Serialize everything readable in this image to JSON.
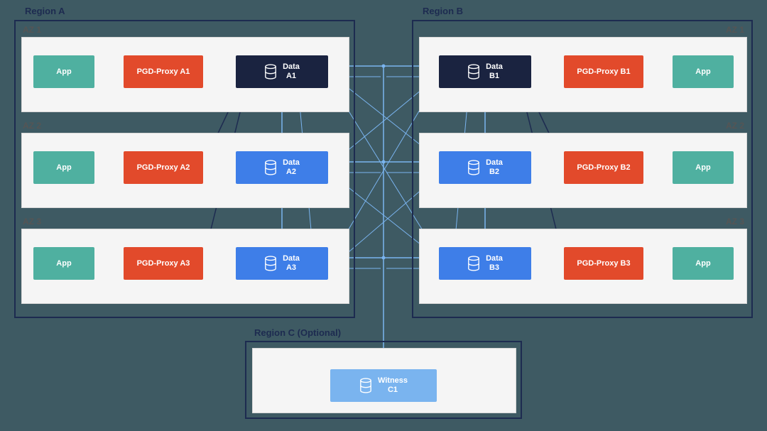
{
  "regions": {
    "a": {
      "label": "Region A",
      "az1": "AZ 1",
      "az2": "AZ 2",
      "az3": "AZ 3"
    },
    "b": {
      "label": "Region B",
      "az1": "AZ 1",
      "az2": "AZ 2",
      "az3": "AZ 3"
    },
    "c": {
      "label": "Region C (Optional)"
    }
  },
  "nodes": {
    "app_label": "App",
    "proxyA1": "PGD-Proxy A1",
    "proxyA2": "PGD-Proxy A2",
    "proxyA3": "PGD-Proxy A3",
    "proxyB1": "PGD-Proxy B1",
    "proxyB2": "PGD-Proxy B2",
    "proxyB3": "PGD-Proxy B3",
    "dataA1": "Data\nA1",
    "dataA2": "Data\nA2",
    "dataA3": "Data\nA3",
    "dataB1": "Data\nB1",
    "dataB2": "Data\nB2",
    "dataB3": "Data\nB3",
    "witnessC1": "Witness\nC1"
  }
}
